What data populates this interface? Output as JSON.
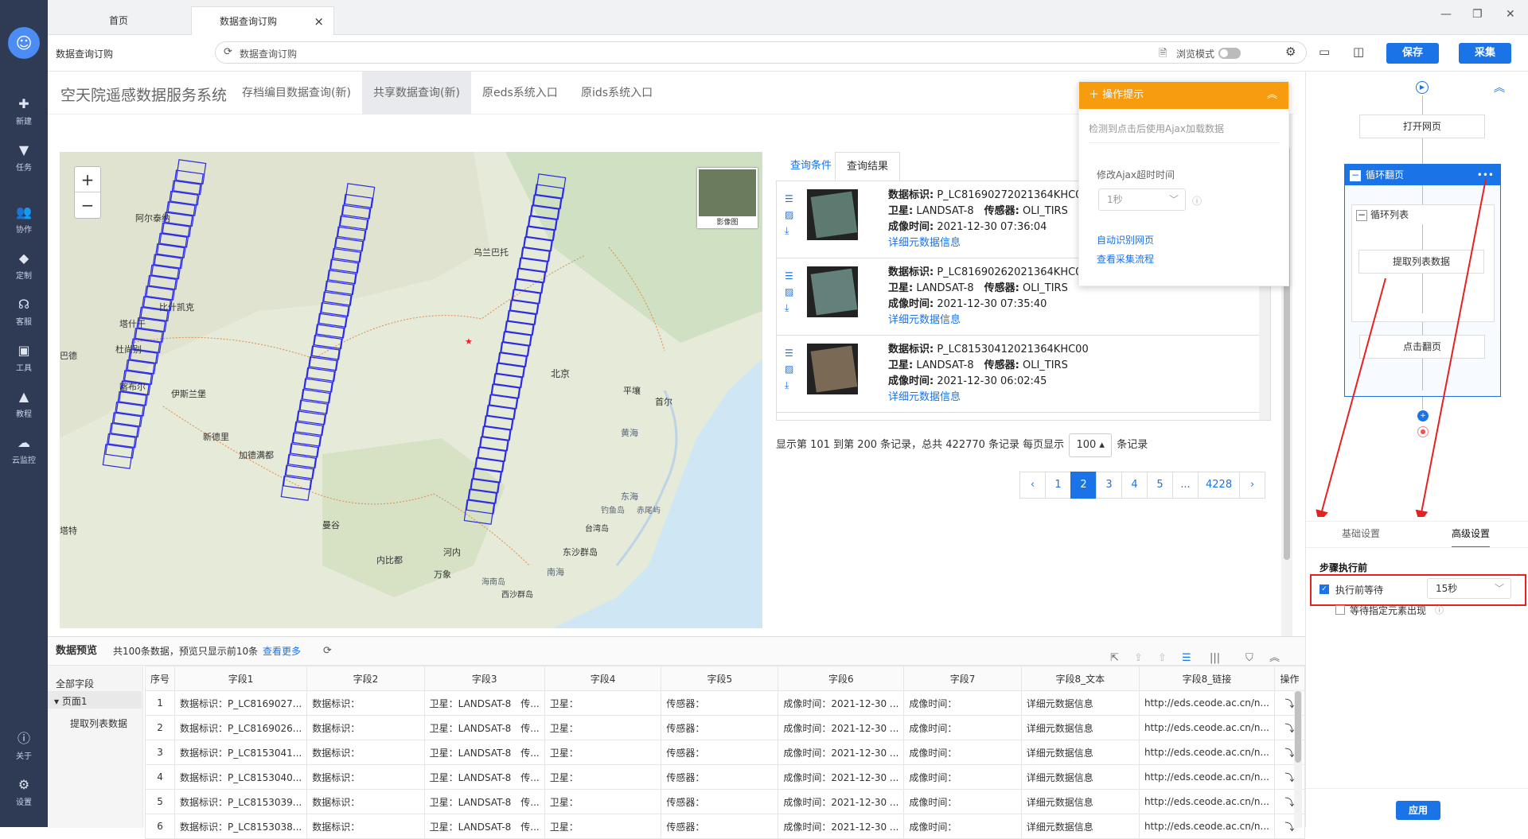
{
  "window": {
    "tabs": [
      {
        "label": "首页"
      },
      {
        "label": "数据查询订购",
        "close": "×"
      }
    ],
    "controls": {
      "minimize": "—",
      "maximize": "❐",
      "close": "✕"
    }
  },
  "leftnav": {
    "items": [
      {
        "label": "新建",
        "icon": "plus-box-icon",
        "glyph": "✚"
      },
      {
        "label": "任务",
        "icon": "bookmark-icon",
        "glyph": "▼"
      },
      {
        "label": "协作",
        "icon": "users-icon",
        "glyph": "👥"
      },
      {
        "label": "定制",
        "icon": "diamond-icon",
        "glyph": "◆"
      },
      {
        "label": "客服",
        "icon": "headset-icon",
        "glyph": "☊"
      },
      {
        "label": "工具",
        "icon": "toolbox-icon",
        "glyph": "▣"
      },
      {
        "label": "教程",
        "icon": "graduation-cap-icon",
        "glyph": "▲"
      },
      {
        "label": "云监控",
        "icon": "cloud-icon",
        "glyph": "☁"
      },
      {
        "label": "关于",
        "icon": "info-icon",
        "glyph": "ⓘ"
      },
      {
        "label": "设置",
        "icon": "gear-icon",
        "glyph": "⚙"
      }
    ]
  },
  "addressbar": {
    "page_label": "数据查询订购",
    "url": "数据查询订购",
    "browse_mode_label": "浏览模式",
    "save_label": "保存",
    "collect_label": "采集"
  },
  "site": {
    "brand": "空天院遥感数据服务系统",
    "nav": [
      "存档编目数据查询(新)",
      "共享数据查询(新)",
      "原eds系统入口",
      "原ids系统入口"
    ]
  },
  "map": {
    "thumb_label": "影像图",
    "labels": [
      "阿尔泰纳",
      "比什凯克",
      "塔什干",
      "杜尚别",
      "巴德",
      "喀布尔",
      "伊斯兰堡",
      "新德里",
      "加德满都",
      "乌兰巴托",
      "北京",
      "平壤",
      "首尔",
      "黄海",
      "东海",
      "钓鱼岛",
      "赤尾屿",
      "台湾岛",
      "东沙群岛",
      "河内",
      "万象",
      "内比都",
      "曼谷",
      "南海",
      "海南岛",
      "西沙群岛",
      "塔特"
    ]
  },
  "results": {
    "tabs": [
      "查询条件",
      "查询结果"
    ],
    "items": [
      {
        "id_label": "数据标识:",
        "id": "P_LC81690272021364KHC00",
        "sat_label": "卫星:",
        "sat": "LANDSAT-8",
        "sensor_label": "传感器:",
        "sensor": "OLI_TIRS",
        "time_label": "成像时间:",
        "time": "2021-12-30 07:36:04",
        "link": "详细元数据信息"
      },
      {
        "id_label": "数据标识:",
        "id": "P_LC81690262021364KHC00",
        "sat_label": "卫星:",
        "sat": "LANDSAT-8",
        "sensor_label": "传感器:",
        "sensor": "OLI_TIRS",
        "time_label": "成像时间:",
        "time": "2021-12-30 07:35:40",
        "link": "详细元数据信息"
      },
      {
        "id_label": "数据标识:",
        "id": "P_LC81530412021364KHC00",
        "sat_label": "卫星:",
        "sat": "LANDSAT-8",
        "sensor_label": "传感器:",
        "sensor": "OLI_TIRS",
        "time_label": "成像时间:",
        "time": "2021-12-30 06:02:45",
        "link": "详细元数据信息"
      }
    ],
    "pageinfo_pre": "显示第 101 到第 200 条记录，总共 422770 条记录 每页显示",
    "perpage": "100 ▴",
    "pageinfo_post": "条记录",
    "pager": [
      "‹",
      "1",
      "2",
      "3",
      "4",
      "5",
      "...",
      "4228",
      "›"
    ]
  },
  "tip": {
    "title": "操作提示",
    "collapse": "︽",
    "detect_text": "检测到点击后使用Ajax加载数据",
    "timeout_label": "修改Ajax超时时间",
    "timeout_value": "1秒",
    "auto_identify": "自动识别网页",
    "view_flow": "查看采集流程"
  },
  "flow": {
    "open_page": "打开网页",
    "loop_page": "循环翻页",
    "loop_list": "循环列表",
    "extract": "提取列表数据",
    "click_next": "点击翻页",
    "more": "•••",
    "settings_tabs": [
      "基础设置",
      "高级设置"
    ],
    "section": "步骤执行前",
    "wait_before": "执行前等待",
    "wait_value": "15秒",
    "wait_element": "等待指定元素出现",
    "apply": "应用"
  },
  "preview": {
    "title": "数据预览",
    "summary": "共100条数据，预览只显示前10条",
    "view_more": "查看更多",
    "tree": {
      "all": "全部字段",
      "page": "页面1",
      "extract": "提取列表数据"
    },
    "columns": [
      "序号",
      "字段1",
      "字段2",
      "字段3",
      "字段4",
      "字段5",
      "字段6",
      "字段7",
      "字段8_文本",
      "字段8_链接",
      "操作"
    ],
    "rows": [
      [
        "1",
        "数据标识：P_LC8169027...",
        "数据标识：",
        "卫星：LANDSAT-8　传...",
        "卫星：",
        "传感器：",
        "成像时间：2021-12-30 ...",
        "成像时间：",
        "详细元数据信息",
        "http://eds.ceode.ac.cn/n...",
        "⤵"
      ],
      [
        "2",
        "数据标识：P_LC8169026...",
        "数据标识：",
        "卫星：LANDSAT-8　传...",
        "卫星：",
        "传感器：",
        "成像时间：2021-12-30 ...",
        "成像时间：",
        "详细元数据信息",
        "http://eds.ceode.ac.cn/n...",
        "⤵"
      ],
      [
        "3",
        "数据标识：P_LC8153041...",
        "数据标识：",
        "卫星：LANDSAT-8　传...",
        "卫星：",
        "传感器：",
        "成像时间：2021-12-30 ...",
        "成像时间：",
        "详细元数据信息",
        "http://eds.ceode.ac.cn/n...",
        "⤵"
      ],
      [
        "4",
        "数据标识：P_LC8153040...",
        "数据标识：",
        "卫星：LANDSAT-8　传...",
        "卫星：",
        "传感器：",
        "成像时间：2021-12-30 ...",
        "成像时间：",
        "详细元数据信息",
        "http://eds.ceode.ac.cn/n...",
        "⤵"
      ],
      [
        "5",
        "数据标识：P_LC8153039...",
        "数据标识：",
        "卫星：LANDSAT-8　传...",
        "卫星：",
        "传感器：",
        "成像时间：2021-12-30 ...",
        "成像时间：",
        "详细元数据信息",
        "http://eds.ceode.ac.cn/n...",
        "⤵"
      ],
      [
        "6",
        "数据标识：P_LC8153038...",
        "数据标识：",
        "卫星：LANDSAT-8　传...",
        "卫星：",
        "传感器：",
        "成像时间：2021-12-30 ...",
        "成像时间：",
        "详细元数据信息",
        "http://eds.ceode.ac.cn/n...",
        "⤵"
      ]
    ]
  },
  "colors": {
    "accent": "#1b73e8",
    "tip_header": "#f79b0f",
    "highlight": "#e52222",
    "nav_bg": "#2f3b55"
  }
}
